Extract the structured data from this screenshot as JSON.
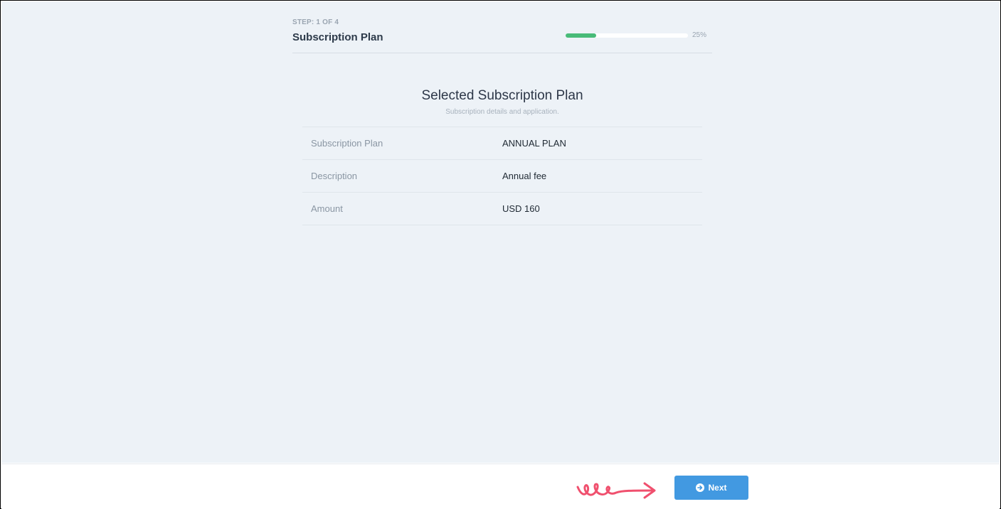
{
  "header": {
    "step_label": "STEP: 1 OF 4",
    "title": "Subscription Plan",
    "progress": {
      "value_percent": 25,
      "text": "25%"
    }
  },
  "card": {
    "title": "Selected Subscription Plan",
    "subtitle": "Subscription details and application.",
    "rows": [
      {
        "label": "Subscription Plan",
        "value": "ANNUAL PLAN"
      },
      {
        "label": "Description",
        "value": "Annual fee"
      },
      {
        "label": "Amount",
        "value": "USD 160"
      }
    ]
  },
  "footer": {
    "next_label": "Next",
    "next_icon": "arrow-circle-right-icon",
    "annotation_icon": "squiggle-arrow-icon"
  },
  "colors": {
    "background": "#edf2f7",
    "progress_fill": "#48bb78",
    "button": "#4299e1",
    "annotation": "#f0506e"
  }
}
